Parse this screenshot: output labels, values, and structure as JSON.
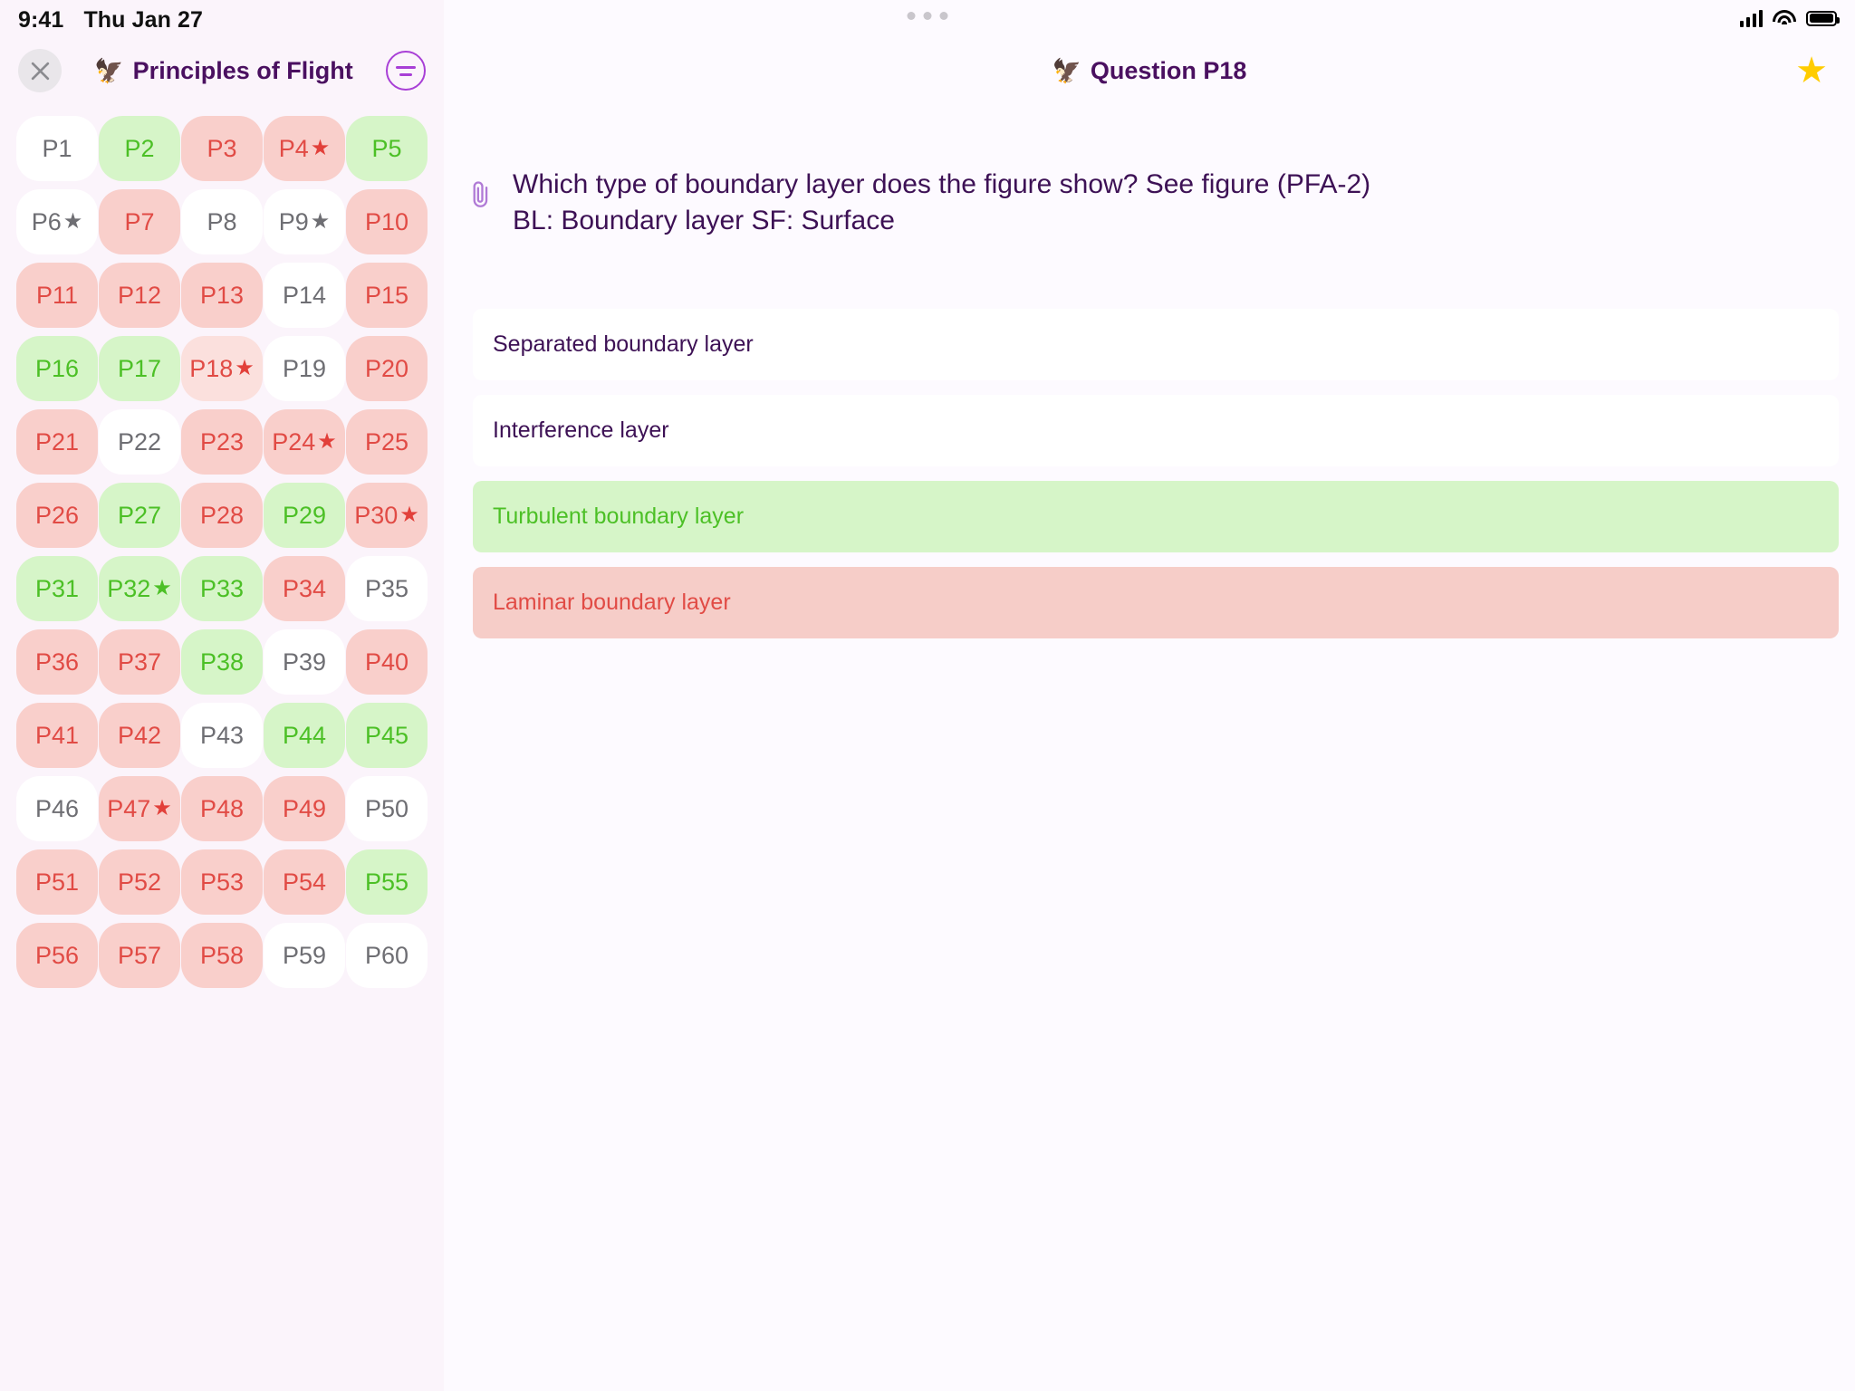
{
  "status_bar": {
    "time": "9:41",
    "date": "Thu Jan 27",
    "signal_icon": "cellular-signal-icon",
    "wifi_icon": "wifi-icon",
    "battery_icon": "battery-icon"
  },
  "sidebar": {
    "close_icon": "close-icon",
    "title": "Principles of Flight",
    "title_emoji": "🦅",
    "filter_icon": "filter-icon",
    "colors": {
      "neutral_bg": "#ffffff",
      "neutral_text": "#6e6e73",
      "correct_bg": "#d6f5c8",
      "correct_text": "#4cc026",
      "wrong_bg": "#f9cfcb",
      "wrong_text": "#e14b45",
      "current_bg": "#fbe0dd",
      "panel_bg": "#fbf4fb"
    },
    "questions": [
      {
        "label": "P1",
        "state": "neutral",
        "starred": false
      },
      {
        "label": "P2",
        "state": "correct",
        "starred": false
      },
      {
        "label": "P3",
        "state": "wrong",
        "starred": false
      },
      {
        "label": "P4",
        "state": "wrong",
        "starred": true
      },
      {
        "label": "P5",
        "state": "correct",
        "starred": false
      },
      {
        "label": "P6",
        "state": "neutral",
        "starred": true
      },
      {
        "label": "P7",
        "state": "wrong",
        "starred": false
      },
      {
        "label": "P8",
        "state": "neutral",
        "starred": false
      },
      {
        "label": "P9",
        "state": "neutral",
        "starred": true
      },
      {
        "label": "P10",
        "state": "wrong",
        "starred": false
      },
      {
        "label": "P11",
        "state": "wrong",
        "starred": false
      },
      {
        "label": "P12",
        "state": "wrong",
        "starred": false
      },
      {
        "label": "P13",
        "state": "wrong",
        "starred": false
      },
      {
        "label": "P14",
        "state": "neutral",
        "starred": false
      },
      {
        "label": "P15",
        "state": "wrong",
        "starred": false
      },
      {
        "label": "P16",
        "state": "correct",
        "starred": false
      },
      {
        "label": "P17",
        "state": "correct",
        "starred": false
      },
      {
        "label": "P18",
        "state": "current",
        "starred": true
      },
      {
        "label": "P19",
        "state": "neutral",
        "starred": false
      },
      {
        "label": "P20",
        "state": "wrong",
        "starred": false
      },
      {
        "label": "P21",
        "state": "wrong",
        "starred": false
      },
      {
        "label": "P22",
        "state": "neutral",
        "starred": false
      },
      {
        "label": "P23",
        "state": "wrong",
        "starred": false
      },
      {
        "label": "P24",
        "state": "wrong",
        "starred": true
      },
      {
        "label": "P25",
        "state": "wrong",
        "starred": false
      },
      {
        "label": "P26",
        "state": "wrong",
        "starred": false
      },
      {
        "label": "P27",
        "state": "correct",
        "starred": false
      },
      {
        "label": "P28",
        "state": "wrong",
        "starred": false
      },
      {
        "label": "P29",
        "state": "correct",
        "starred": false
      },
      {
        "label": "P30",
        "state": "wrong",
        "starred": true
      },
      {
        "label": "P31",
        "state": "correct",
        "starred": false
      },
      {
        "label": "P32",
        "state": "correct",
        "starred": true
      },
      {
        "label": "P33",
        "state": "correct",
        "starred": false
      },
      {
        "label": "P34",
        "state": "wrong",
        "starred": false
      },
      {
        "label": "P35",
        "state": "neutral",
        "starred": false
      },
      {
        "label": "P36",
        "state": "wrong",
        "starred": false
      },
      {
        "label": "P37",
        "state": "wrong",
        "starred": false
      },
      {
        "label": "P38",
        "state": "correct",
        "starred": false
      },
      {
        "label": "P39",
        "state": "neutral",
        "starred": false
      },
      {
        "label": "P40",
        "state": "wrong",
        "starred": false
      },
      {
        "label": "P41",
        "state": "wrong",
        "starred": false
      },
      {
        "label": "P42",
        "state": "wrong",
        "starred": false
      },
      {
        "label": "P43",
        "state": "neutral",
        "starred": false
      },
      {
        "label": "P44",
        "state": "correct",
        "starred": false
      },
      {
        "label": "P45",
        "state": "correct",
        "starred": false
      },
      {
        "label": "P46",
        "state": "neutral",
        "starred": false
      },
      {
        "label": "P47",
        "state": "wrong",
        "starred": true
      },
      {
        "label": "P48",
        "state": "wrong",
        "starred": false
      },
      {
        "label": "P49",
        "state": "wrong",
        "starred": false
      },
      {
        "label": "P50",
        "state": "neutral",
        "starred": false
      },
      {
        "label": "P51",
        "state": "wrong",
        "starred": false
      },
      {
        "label": "P52",
        "state": "wrong",
        "starred": false
      },
      {
        "label": "P53",
        "state": "wrong",
        "starred": false
      },
      {
        "label": "P54",
        "state": "wrong",
        "starred": false
      },
      {
        "label": "P55",
        "state": "correct",
        "starred": false
      },
      {
        "label": "P56",
        "state": "wrong",
        "starred": false
      },
      {
        "label": "P57",
        "state": "wrong",
        "starred": false
      },
      {
        "label": "P58",
        "state": "wrong",
        "starred": false
      },
      {
        "label": "P59",
        "state": "neutral",
        "starred": false
      },
      {
        "label": "P60",
        "state": "neutral",
        "starred": false
      }
    ]
  },
  "main": {
    "title": "Question P18",
    "title_emoji": "🦅",
    "favorite_icon": "star-icon",
    "favorite_color": "#ffcc00",
    "attachment_icon": "paperclip-icon",
    "question_text": "Which type of boundary layer does the figure show? See figure (PFA-2) BL: Boundary layer SF: Surface",
    "options": [
      {
        "label": "Separated boundary layer",
        "state": "plain"
      },
      {
        "label": "Interference layer",
        "state": "plain"
      },
      {
        "label": "Turbulent boundary layer",
        "state": "right"
      },
      {
        "label": "Laminar boundary layer",
        "state": "wrongpick"
      }
    ]
  }
}
